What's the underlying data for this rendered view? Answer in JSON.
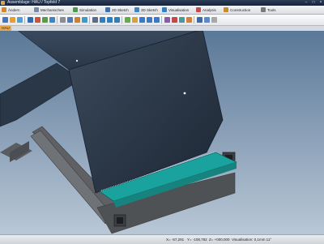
{
  "window": {
    "title": "Assemblage: HAU / Topfeld 7",
    "controls": [
      "–",
      "□",
      "×"
    ]
  },
  "menu": {
    "tabs": [
      {
        "label": "Ändern",
        "icon": "edit-icon"
      },
      {
        "label": "Mechanisches",
        "icon": "gear-icon"
      },
      {
        "label": "Simulation",
        "icon": "simulation-icon"
      },
      {
        "label": "2D Sketch",
        "icon": "sketch-2d-icon"
      },
      {
        "label": "3D Sketch",
        "icon": "sketch-3d-icon"
      },
      {
        "label": "Visualisation",
        "icon": "visualisation-icon"
      },
      {
        "label": "Analysis",
        "icon": "analysis-icon"
      },
      {
        "label": "Construction",
        "icon": "construction-icon"
      },
      {
        "label": "Tools",
        "icon": "tools-icon"
      }
    ]
  },
  "document": {
    "tab_label": "HAU"
  },
  "status": {
    "x": "X= -57,291",
    "y": "Y= -108,782",
    "z": "Z= +000,000",
    "visualisation": "Visualisation: 0,1mm 11°"
  },
  "colors": {
    "viewport_top": "#5a7898",
    "viewport_bottom": "#b9c7d6",
    "panel": "#2e3c4d",
    "beam": "#5e6063",
    "accent": "#1aa39e"
  }
}
